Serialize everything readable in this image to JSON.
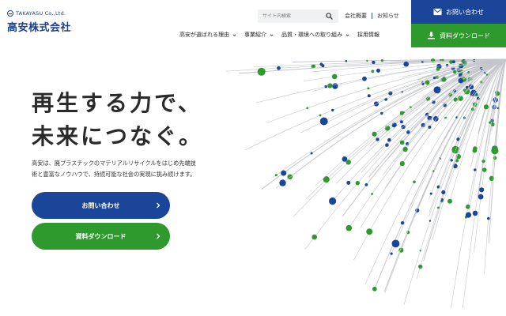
{
  "logo": {
    "en": "TAKAYASU Co.,Ltd.",
    "jp": "高安株式会社"
  },
  "search": {
    "placeholder": "サイト内検索"
  },
  "util_links": [
    {
      "label": "会社概要"
    },
    {
      "label": "お知らせ"
    }
  ],
  "nav": [
    {
      "label": "高安が選ばれる理由",
      "dropdown": true
    },
    {
      "label": "事業紹介",
      "dropdown": true
    },
    {
      "label": "品質・環境への取り組み",
      "dropdown": true
    },
    {
      "label": "採用情報",
      "dropdown": false
    }
  ],
  "header_cta": {
    "contact": "お問い合わせ",
    "download": "資料ダウンロード"
  },
  "hero": {
    "title_line1": "再生する力で、",
    "title_line2": "未来につなぐ。",
    "desc_line1": "高安は、廃プラスチックのマテリアルリサイクルをはじめ先端技",
    "desc_line2": "術と豊富なノウハウで、持続可能な社会の実現に挑み続けます。",
    "btn_contact": "お問い合わせ",
    "btn_download": "資料ダウンロード"
  },
  "colors": {
    "blue": "#1a4599",
    "green": "#2e9a2e",
    "line": "#c4c6cb"
  },
  "icons": [
    "search-icon",
    "mail-icon",
    "download-icon",
    "chevron-down-icon",
    "chevron-right-icon"
  ]
}
